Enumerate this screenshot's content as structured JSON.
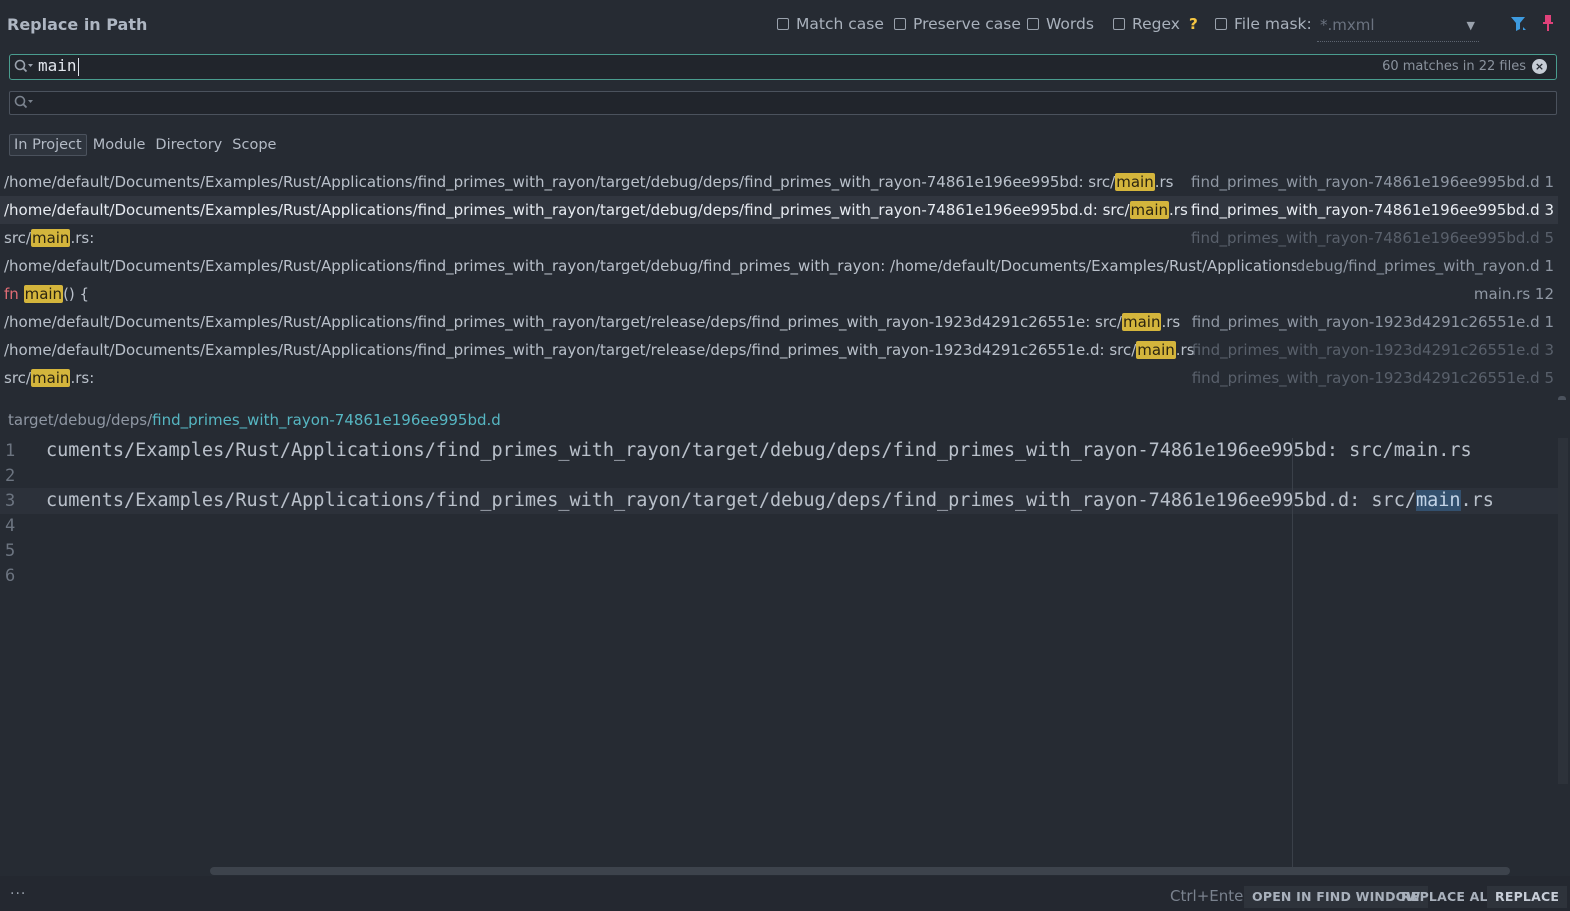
{
  "dialog": {
    "title": "Replace in Path"
  },
  "options": {
    "match_case": "Match case",
    "preserve_case": "Preserve case",
    "words": "Words",
    "regex": "Regex",
    "regex_help": "?",
    "file_mask": "File mask:",
    "file_mask_value": "*.mxml"
  },
  "search": {
    "query": "main",
    "matches": "60 matches in 22 files"
  },
  "replace": {
    "value": ""
  },
  "scopes": [
    "In Project",
    "Module",
    "Directory",
    "Scope"
  ],
  "results": [
    {
      "left_pre": "/home/default/Documents/Examples/Rust/Applications/find_primes_with_rayon/target/debug/deps/find_primes_with_rayon-74861e196ee995bd: src/",
      "match": "main",
      "left_post": ".rs",
      "right": "find_primes_with_rayon-74861e196ee995bd.d 1"
    },
    {
      "left_pre": "/home/default/Documents/Examples/Rust/Applications/find_primes_with_rayon/target/debug/deps/find_primes_with_rayon-74861e196ee995bd.d: src/",
      "match": "main",
      "left_post": ".rs",
      "right": "find_primes_with_rayon-74861e196ee995bd.d 3"
    },
    {
      "left_pre": "src/",
      "match": "main",
      "left_post": ".rs:",
      "right": "find_primes_with_rayon-74861e196ee995bd.d 5"
    },
    {
      "left_pre": "/home/default/Documents/Examples/Rust/Applications/find_primes_with_rayon/target/debug/find_primes_with_rayon: /home/default/Documents/Examples/Rust/Applications/find_",
      "match": "",
      "left_post": "",
      "right": "debug/find_primes_with_rayon.d 1"
    },
    {
      "kw": "fn",
      "match": "main",
      "left_post": "() {",
      "right": "main.rs 12"
    },
    {
      "left_pre": "/home/default/Documents/Examples/Rust/Applications/find_primes_with_rayon/target/release/deps/find_primes_with_rayon-1923d4291c26551e: src/",
      "match": "main",
      "left_post": ".rs",
      "right": "find_primes_with_rayon-1923d4291c26551e.d 1"
    },
    {
      "left_pre": "/home/default/Documents/Examples/Rust/Applications/find_primes_with_rayon/target/release/deps/find_primes_with_rayon-1923d4291c26551e.d: src/",
      "match": "main",
      "left_post": ".rs",
      "right": "find_primes_with_rayon-1923d4291c26551e.d 3"
    },
    {
      "left_pre": "src/",
      "match": "main",
      "left_post": ".rs:",
      "right": "find_primes_with_rayon-1923d4291c26551e.d 5"
    }
  ],
  "preview": {
    "path_prefix": "target/debug/deps/",
    "filename": "find_primes_with_rayon-74861e196ee995bd.d",
    "line_numbers": [
      "1",
      "2",
      "3",
      "4",
      "5",
      "6"
    ],
    "line1": "cuments/Examples/Rust/Applications/find_primes_with_rayon/target/debug/deps/find_primes_with_rayon-74861e196ee995bd: src/main.rs",
    "line3_pre": "cuments/Examples/Rust/Applications/find_primes_with_rayon/target/debug/deps/find_primes_with_rayon-74861e196ee995bd.d: src/",
    "line3_match": "main",
    "line3_post": ".rs"
  },
  "footer": {
    "dots": "...",
    "hint": "Ctrl+Enter",
    "open_in_find_window": "OPEN IN FIND WINDOW",
    "replace_all": "REPLACE ALL",
    "replace": "REPLACE"
  },
  "colors": {
    "accent": "#4a9d8f",
    "match_highlight": "#d4b53c",
    "keyword": "#e06c75",
    "link": "#56b6c2",
    "background": "#262b33"
  }
}
